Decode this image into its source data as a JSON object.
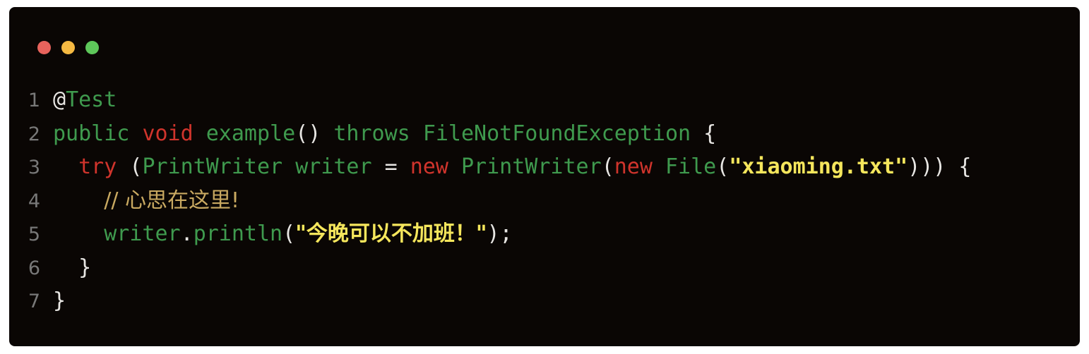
{
  "window": {
    "background_color": "#0a0604",
    "page_background_color": "#ffffff",
    "traffic_lights": [
      {
        "name": "close",
        "color": "#e8635c"
      },
      {
        "name": "minimize",
        "color": "#f5b942"
      },
      {
        "name": "maximize",
        "color": "#5ec75a"
      }
    ]
  },
  "editor": {
    "language": "java",
    "theme": {
      "plain": "#e8e6e3",
      "identifier": "#3f9a4e",
      "keyword": "#d0342c",
      "string": "#f5e65c",
      "comment": "#c9a961",
      "line_number": "#787878"
    },
    "line_numbers": [
      "1",
      "2",
      "3",
      "4",
      "5",
      "6",
      "7"
    ],
    "lines": [
      {
        "number": "1",
        "text": "@Test",
        "tokens": [
          {
            "t": "@",
            "c": "plain"
          },
          {
            "t": "Test",
            "c": "ident"
          }
        ]
      },
      {
        "number": "2",
        "text": "public void example() throws FileNotFoundException {",
        "tokens": [
          {
            "t": "public",
            "c": "ident"
          },
          {
            "t": " ",
            "c": "plain"
          },
          {
            "t": "void",
            "c": "keyword"
          },
          {
            "t": " ",
            "c": "plain"
          },
          {
            "t": "example",
            "c": "ident"
          },
          {
            "t": "()",
            "c": "plain"
          },
          {
            "t": " ",
            "c": "plain"
          },
          {
            "t": "throws",
            "c": "ident"
          },
          {
            "t": " ",
            "c": "plain"
          },
          {
            "t": "FileNotFoundException",
            "c": "ident"
          },
          {
            "t": " {",
            "c": "plain"
          }
        ]
      },
      {
        "number": "3",
        "text": "  try (PrintWriter writer = new PrintWriter(new File(\"xiaoming.txt\"))) {",
        "tokens": [
          {
            "t": "  ",
            "c": "plain"
          },
          {
            "t": "try",
            "c": "keyword"
          },
          {
            "t": " ",
            "c": "plain"
          },
          {
            "t": "(",
            "c": "plain"
          },
          {
            "t": "PrintWriter",
            "c": "ident"
          },
          {
            "t": " ",
            "c": "plain"
          },
          {
            "t": "writer",
            "c": "ident"
          },
          {
            "t": " ",
            "c": "plain"
          },
          {
            "t": "=",
            "c": "plain"
          },
          {
            "t": " ",
            "c": "plain"
          },
          {
            "t": "new",
            "c": "keyword"
          },
          {
            "t": " ",
            "c": "plain"
          },
          {
            "t": "PrintWriter",
            "c": "ident"
          },
          {
            "t": "(",
            "c": "plain"
          },
          {
            "t": "new",
            "c": "keyword"
          },
          {
            "t": " ",
            "c": "plain"
          },
          {
            "t": "File",
            "c": "ident"
          },
          {
            "t": "(",
            "c": "plain"
          },
          {
            "t": "\"xiaoming.txt\"",
            "c": "string"
          },
          {
            "t": "))) {",
            "c": "plain"
          }
        ]
      },
      {
        "number": "4",
        "text": "    // 心思在这里!",
        "tokens": [
          {
            "t": "    ",
            "c": "plain"
          },
          {
            "t": "// 心思在这里!",
            "c": "comment"
          }
        ]
      },
      {
        "number": "5",
        "text": "    writer.println(\"今晚可以不加班！\");",
        "tokens": [
          {
            "t": "    ",
            "c": "plain"
          },
          {
            "t": "writer",
            "c": "ident"
          },
          {
            "t": ".",
            "c": "plain"
          },
          {
            "t": "println",
            "c": "ident"
          },
          {
            "t": "(",
            "c": "plain"
          },
          {
            "t": "\"今晚可以不加班！\"",
            "c": "string"
          },
          {
            "t": ");",
            "c": "plain"
          }
        ]
      },
      {
        "number": "6",
        "text": "  }",
        "tokens": [
          {
            "t": "  ",
            "c": "plain"
          },
          {
            "t": "}",
            "c": "plain"
          }
        ]
      },
      {
        "number": "7",
        "text": "}",
        "tokens": [
          {
            "t": "}",
            "c": "plain"
          }
        ]
      }
    ]
  }
}
